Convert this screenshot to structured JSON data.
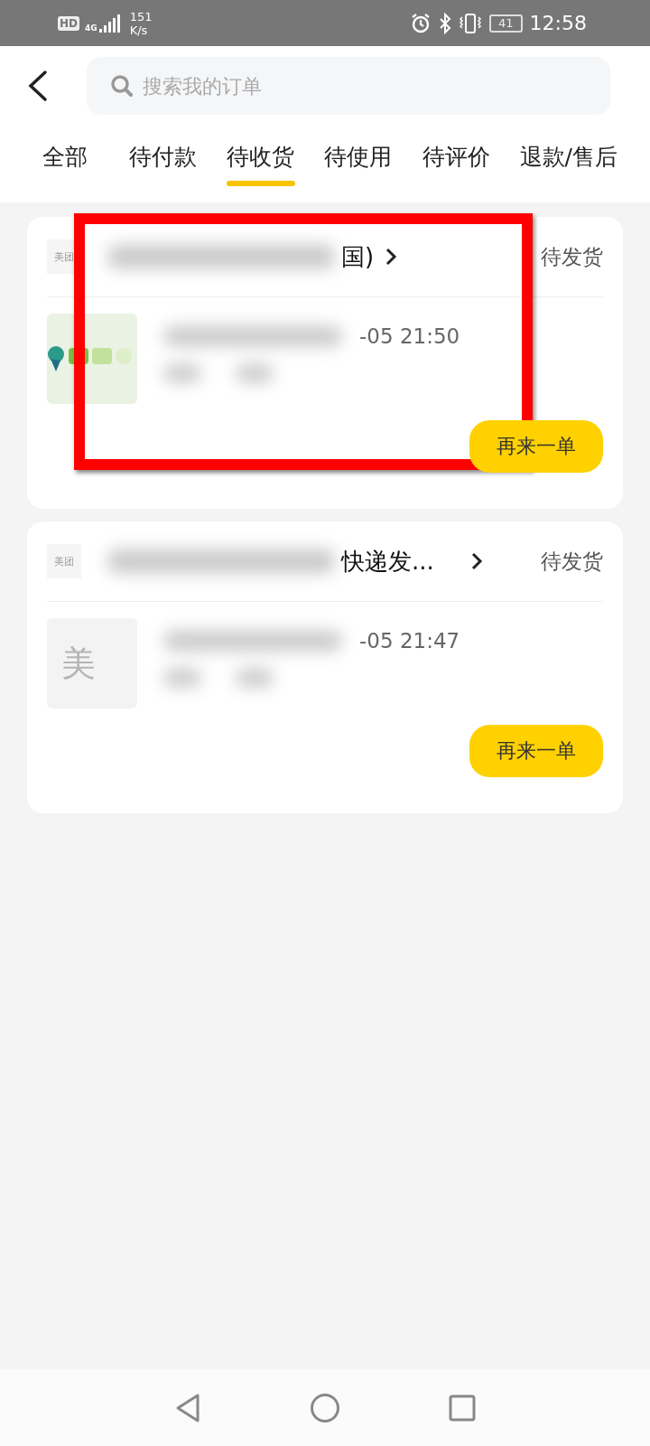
{
  "status_bar": {
    "hd": "HD",
    "network": "4G",
    "speed": "151",
    "speed_unit": "K/s",
    "battery": "41",
    "time": "12:58"
  },
  "search": {
    "placeholder": "搜索我的订单"
  },
  "tabs": [
    {
      "label": "全部",
      "selected": false
    },
    {
      "label": "待付款",
      "selected": false
    },
    {
      "label": "待收货",
      "selected": true
    },
    {
      "label": "待使用",
      "selected": false
    },
    {
      "label": "待评价",
      "selected": false
    },
    {
      "label": "退款/售后",
      "selected": false
    }
  ],
  "orders": [
    {
      "shop_logo": "美团",
      "title": "国)",
      "status": "待发货",
      "time": "-05 21:50",
      "button": "再来一单",
      "highlighted": true
    },
    {
      "shop_logo": "美团",
      "title": "快递发...",
      "status": "待发货",
      "thumb": {
        "kind": "placeholder",
        "text": "美"
      },
      "time": "-05 21:47",
      "button": "再来一单",
      "highlighted": false
    }
  ]
}
